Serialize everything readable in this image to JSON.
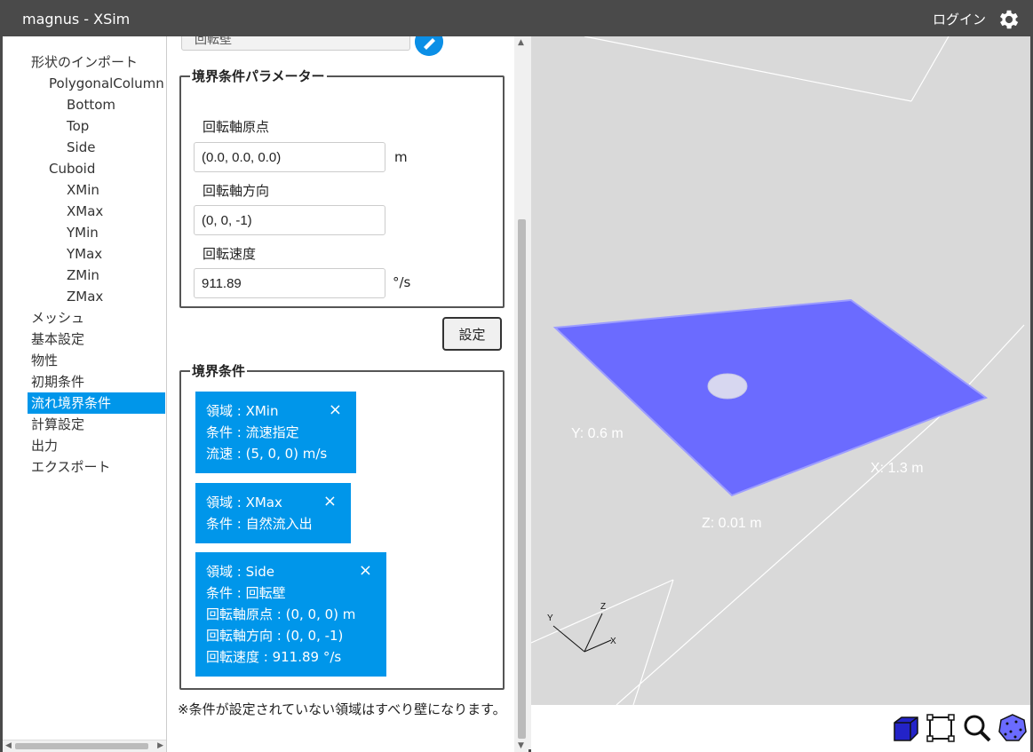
{
  "app": {
    "title": "magnus - XSim",
    "login_label": "ログイン"
  },
  "tree": {
    "items": [
      {
        "label": "形状のインポート",
        "indent": 0
      },
      {
        "label": "PolygonalColumn",
        "indent": 1
      },
      {
        "label": "Bottom",
        "indent": 2
      },
      {
        "label": "Top",
        "indent": 2
      },
      {
        "label": "Side",
        "indent": 2
      },
      {
        "label": "Cuboid",
        "indent": 1
      },
      {
        "label": "XMin",
        "indent": 2
      },
      {
        "label": "XMax",
        "indent": 2
      },
      {
        "label": "YMin",
        "indent": 2
      },
      {
        "label": "YMax",
        "indent": 2
      },
      {
        "label": "ZMin",
        "indent": 2
      },
      {
        "label": "ZMax",
        "indent": 2
      },
      {
        "label": "メッシュ",
        "indent": 0
      },
      {
        "label": "基本設定",
        "indent": 0
      },
      {
        "label": "物性",
        "indent": 0
      },
      {
        "label": "初期条件",
        "indent": 0
      },
      {
        "label": "流れ境界条件",
        "indent": 0,
        "selected": true
      },
      {
        "label": "計算設定",
        "indent": 0
      },
      {
        "label": "出力",
        "indent": 0
      },
      {
        "label": "エクスポート",
        "indent": 0
      }
    ]
  },
  "panel": {
    "top_partial_value": "回転壁",
    "params_legend": "境界条件パラメーター",
    "origin_label": "回転軸原点",
    "origin_value": "(0.0, 0.0, 0.0)",
    "origin_unit": "m",
    "direction_label": "回転軸方向",
    "direction_value": "(0, 0, -1)",
    "speed_label": "回転速度",
    "speed_value": "911.89",
    "speed_unit": "°/s",
    "set_label": "設定",
    "conditions_legend": "境界条件",
    "conditions": [
      {
        "lines": [
          "領域 : XMin",
          "条件 : 流速指定",
          "流速 : (5, 0, 0) m/s"
        ]
      },
      {
        "lines": [
          "領域 : XMax",
          "条件 : 自然流入出"
        ]
      },
      {
        "lines": [
          "領域 : Side",
          "条件 : 回転壁",
          "回転軸原点 : (0, 0, 0) m",
          "回転軸方向 : (0, 0, -1)",
          "回転速度 : 911.89 °/s"
        ]
      }
    ],
    "close_glyph": "×",
    "note": "※条件が設定されていない領域はすべり壁になります。"
  },
  "viewport": {
    "dim_x": "X: 1.3 m",
    "dim_y": "Y: 0.6 m",
    "dim_z": "Z: 0.01 m",
    "axis_x": "X",
    "axis_y": "Y",
    "axis_z": "Z",
    "plane_color": "#6b6bff"
  },
  "colors": {
    "accent": "#0096ea",
    "titlebar": "#4a4a4a"
  },
  "toolbar": {
    "tools": [
      "cube-view-icon",
      "fit-frame-icon",
      "zoom-icon",
      "mesh-sphere-icon"
    ]
  }
}
